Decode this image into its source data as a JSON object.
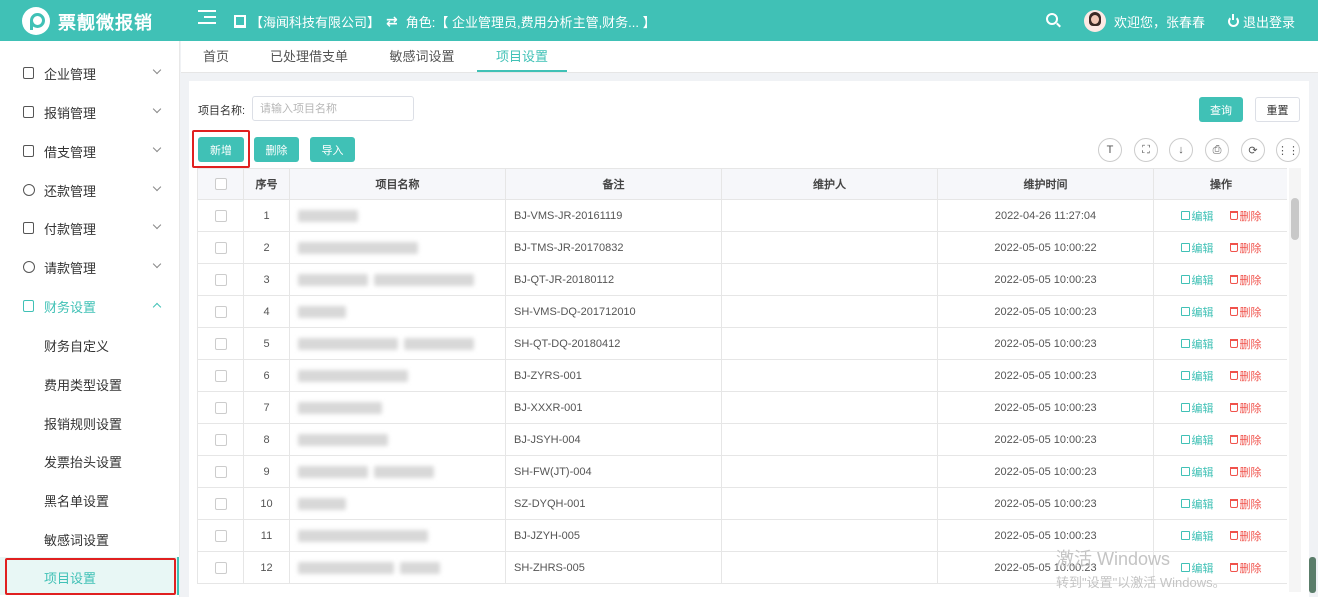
{
  "app": {
    "brand": "票靓微报销"
  },
  "header": {
    "company": "【海闻科技有限公司】",
    "role": "角色:【 企业管理员,费用分析主管,财务... 】",
    "welcome": "欢迎您，张春春",
    "logout": "退出登录"
  },
  "sidebar": {
    "items": [
      {
        "label": "企业管理"
      },
      {
        "label": "报销管理"
      },
      {
        "label": "借支管理"
      },
      {
        "label": "还款管理"
      },
      {
        "label": "付款管理"
      },
      {
        "label": "请款管理"
      },
      {
        "label": "财务设置"
      }
    ],
    "sub_items": [
      {
        "label": "财务自定义"
      },
      {
        "label": "费用类型设置"
      },
      {
        "label": "报销规则设置"
      },
      {
        "label": "发票抬头设置"
      },
      {
        "label": "黑名单设置"
      },
      {
        "label": "敏感词设置"
      },
      {
        "label": "项目设置"
      }
    ]
  },
  "tabs": [
    {
      "label": "首页"
    },
    {
      "label": "已处理借支单"
    },
    {
      "label": "敏感词设置"
    },
    {
      "label": "项目设置"
    }
  ],
  "search": {
    "label": "项目名称:",
    "placeholder": "请输入项目名称",
    "value": "",
    "query_label": "查询",
    "reset_label": "重置"
  },
  "toolbar": {
    "add_label": "新增",
    "delete_label": "删除",
    "import_label": "导入"
  },
  "table": {
    "columns": [
      "序号",
      "项目名称",
      "备注",
      "维护人",
      "维护时间",
      "操作"
    ],
    "edit_label": "编辑",
    "delete_label": "删除",
    "rows": [
      {
        "no": "1",
        "remark": "BJ-VMS-JR-20161119",
        "maintainer": "",
        "time": "2022-04-26 11:27:04"
      },
      {
        "no": "2",
        "remark": "BJ-TMS-JR-20170832",
        "maintainer": "",
        "time": "2022-05-05 10:00:22"
      },
      {
        "no": "3",
        "remark": "BJ-QT-JR-20180112",
        "maintainer": "",
        "time": "2022-05-05 10:00:23"
      },
      {
        "no": "4",
        "remark": "SH-VMS-DQ-201712010",
        "maintainer": "",
        "time": "2022-05-05 10:00:23"
      },
      {
        "no": "5",
        "remark": "SH-QT-DQ-20180412",
        "maintainer": "",
        "time": "2022-05-05 10:00:23"
      },
      {
        "no": "6",
        "remark": "BJ-ZYRS-001",
        "maintainer": "",
        "time": "2022-05-05 10:00:23"
      },
      {
        "no": "7",
        "remark": "BJ-XXXR-001",
        "maintainer": "",
        "time": "2022-05-05 10:00:23"
      },
      {
        "no": "8",
        "remark": "BJ-JSYH-004",
        "maintainer": "",
        "time": "2022-05-05 10:00:23"
      },
      {
        "no": "9",
        "remark": "SH-FW(JT)-004",
        "maintainer": "",
        "time": "2022-05-05 10:00:23"
      },
      {
        "no": "10",
        "remark": "SZ-DYQH-001",
        "maintainer": "",
        "time": "2022-05-05 10:00:23"
      },
      {
        "no": "11",
        "remark": "BJ-JZYH-005",
        "maintainer": "",
        "time": "2022-05-05 10:00:23"
      },
      {
        "no": "12",
        "remark": "SH-ZHRS-005",
        "maintainer": "",
        "time": "2022-05-05 10:00:23"
      }
    ]
  },
  "watermark": {
    "line1": "激活 Windows",
    "line2": "转到\"设置\"以激活 Windows。"
  },
  "colors": {
    "accent": "#40c1b6",
    "danger": "#f0524b",
    "highlight": "#e02020"
  }
}
